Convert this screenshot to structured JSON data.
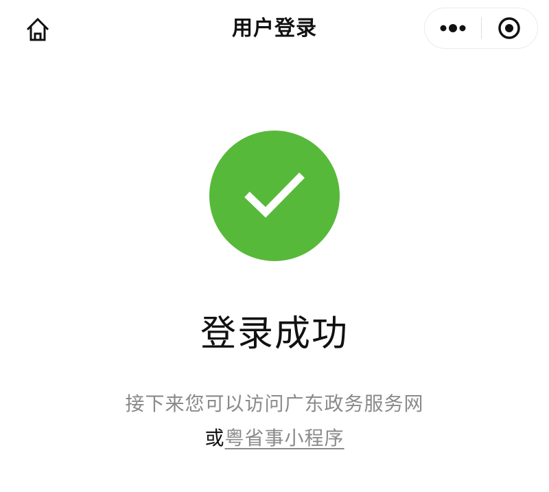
{
  "nav": {
    "title": "用户登录",
    "home_icon": "home-icon",
    "more_icon": "more-dots-icon",
    "close_icon": "target-close-icon"
  },
  "result": {
    "icon": "check-icon",
    "icon_color": "#57b93a",
    "title": "登录成功",
    "desc_line1": "接下来您可以访问广东政务服务网",
    "desc_prefix": "或",
    "link_text": "粤省事小程序"
  }
}
